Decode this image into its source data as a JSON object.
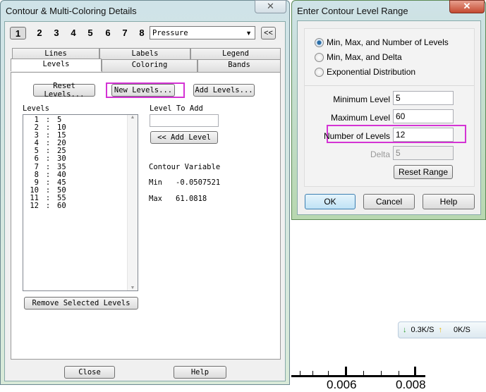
{
  "contour_dialog": {
    "title": "Contour & Multi-Coloring Details",
    "close_glyph": "✕",
    "group_numbers": [
      "1",
      "2",
      "3",
      "4",
      "5",
      "6",
      "7",
      "8"
    ],
    "variable_select": "Pressure",
    "collapse_label": "<<",
    "tabs_row1": [
      "Lines",
      "Labels",
      "Legend"
    ],
    "tabs_row2": [
      "Levels",
      "Coloring",
      "Bands"
    ],
    "reset_levels": "Reset Levels...",
    "new_levels": "New Levels...",
    "add_levels": "Add Levels...",
    "levels_label": "Levels",
    "levels": [
      [
        "1",
        "5"
      ],
      [
        "2",
        "10"
      ],
      [
        "3",
        "15"
      ],
      [
        "4",
        "20"
      ],
      [
        "5",
        "25"
      ],
      [
        "6",
        "30"
      ],
      [
        "7",
        "35"
      ],
      [
        "8",
        "40"
      ],
      [
        "9",
        "45"
      ],
      [
        "10",
        "50"
      ],
      [
        "11",
        "55"
      ],
      [
        "12",
        "60"
      ]
    ],
    "level_to_add_label": "Level To Add",
    "level_to_add_value": "",
    "add_level_button": "<< Add Level",
    "contour_variable_label": "Contour Variable",
    "min_label": "Min",
    "min_value": "-0.0507521",
    "max_label": "Max",
    "max_value": "61.0818",
    "remove_selected": "Remove Selected Levels",
    "close_button": "Close",
    "help_button": "Help"
  },
  "range_dialog": {
    "title": "Enter Contour Level Range",
    "close_glyph": "✕",
    "options": [
      "Min, Max, and Number of Levels",
      "Min, Max, and Delta",
      "Exponential Distribution"
    ],
    "selected_option": 0,
    "min_label": "Minimum Level",
    "min_value": "5",
    "max_label": "Maximum Level",
    "max_value": "60",
    "num_label": "Number of Levels",
    "num_value": "12",
    "delta_label": "Delta",
    "delta_value": "5",
    "reset_range": "Reset Range",
    "ok": "OK",
    "cancel": "Cancel",
    "help": "Help"
  },
  "background": {
    "axis_ticks": [
      "0.006",
      "0.008"
    ],
    "net_down": "0.3K/S",
    "net_up": "0K/S"
  }
}
